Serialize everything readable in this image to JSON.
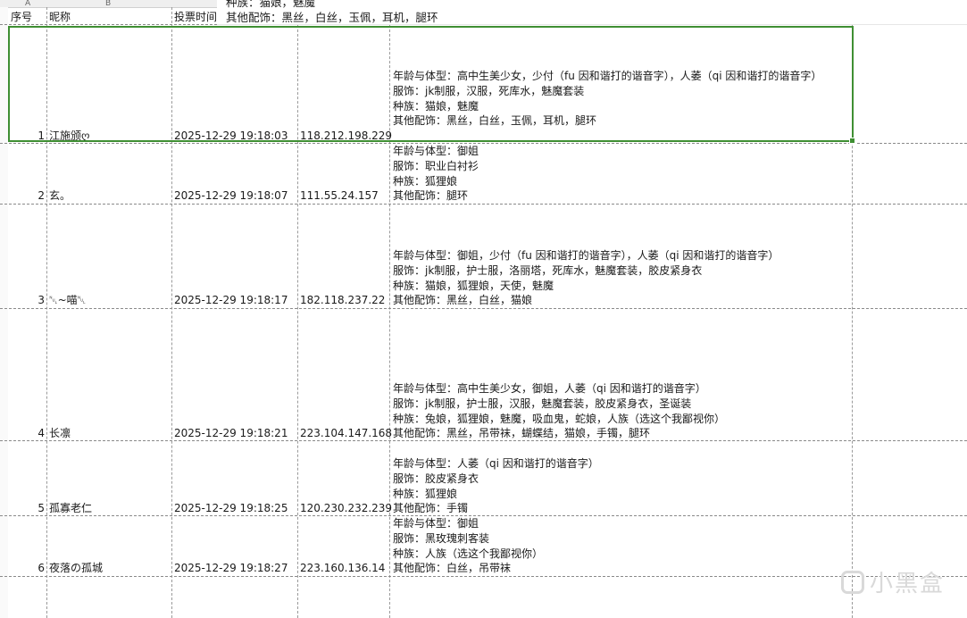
{
  "column_letters": {
    "a": "A",
    "b": "B"
  },
  "tooltip": {
    "line1": "种族：猫娘，魅魔",
    "line2": "其他配饰：黑丝，白丝，玉佩，耳机，腿环"
  },
  "headers": {
    "seq": "序号",
    "nickname": "昵称",
    "vote_time": "投票时间"
  },
  "rows": [
    {
      "seq": "1",
      "nickname": "江施颁ღ",
      "time": "2025-12-29 19:18:03",
      "ip": "118.212.198.229",
      "lines": [
        "年龄与体型：高中生美少女，少付（fu 因和谐打的谐音字），人萎（qi 因和谐打的谐音字）",
        "服饰：jk制服，汉服，死库水，魅魔套装",
        "种族：猫娘，魅魔",
        "其他配饰：黑丝，白丝，玉佩，耳机，腿环"
      ]
    },
    {
      "seq": "2",
      "nickname": "玄。",
      "time": "2025-12-29 19:18:07",
      "ip": "111.55.24.157",
      "lines": [
        "年龄与体型：御姐",
        "服饰：职业白衬衫",
        "种族：狐狸娘",
        "其他配饰：腿环"
      ]
    },
    {
      "seq": "3",
      "nickname": "␀~喵␀",
      "time": "2025-12-29 19:18:17",
      "ip": "182.118.237.22",
      "lines": [
        "年龄与体型：御姐，少付（fu 因和谐打的谐音字），人萎（qi 因和谐打的谐音字）",
        "服饰：jk制服，护士服，洛丽塔，死库水，魅魔套装，胶皮紧身衣",
        "种族：猫娘，狐狸娘，天使，魅魔",
        "其他配饰：黑丝，白丝，猫娘"
      ]
    },
    {
      "seq": "4",
      "nickname": "长凛",
      "time": "2025-12-29 19:18:21",
      "ip": "223.104.147.168",
      "lines": [
        "年龄与体型：高中生美少女，御姐，人萎（qi 因和谐打的谐音字）",
        "服饰：jk制服，护士服，汉服，魅魔套装，胶皮紧身衣，圣诞装",
        "种族：兔娘，狐狸娘，魅魔，吸血鬼，蛇娘，人族（选这个我鄙视你）",
        "其他配饰：黑丝，吊带袜，蝴蝶结，猫娘，手镯，腿环"
      ]
    },
    {
      "seq": "5",
      "nickname": "孤寡老仁",
      "time": "2025-12-29 19:18:25",
      "ip": "120.230.232.239",
      "lines": [
        "年龄与体型：人萎（qi 因和谐打的谐音字）",
        "服饰：胶皮紧身衣",
        "种族：狐狸娘",
        "其他配饰：手镯"
      ]
    },
    {
      "seq": "6",
      "nickname": "夜落の孤城",
      "time": "2025-12-29 19:18:27",
      "ip": "223.160.136.14",
      "lines": [
        "年龄与体型：御姐",
        "服饰：黑玫瑰刺客装",
        "种族：人族（选这个我鄙视你）",
        "其他配饰：白丝，吊带袜"
      ]
    }
  ],
  "watermark": {
    "text": "小黑盒",
    "icon": "heybox-logo-icon"
  },
  "colors": {
    "selection": "#3f8f33",
    "gridline": "#9a9a9a"
  }
}
